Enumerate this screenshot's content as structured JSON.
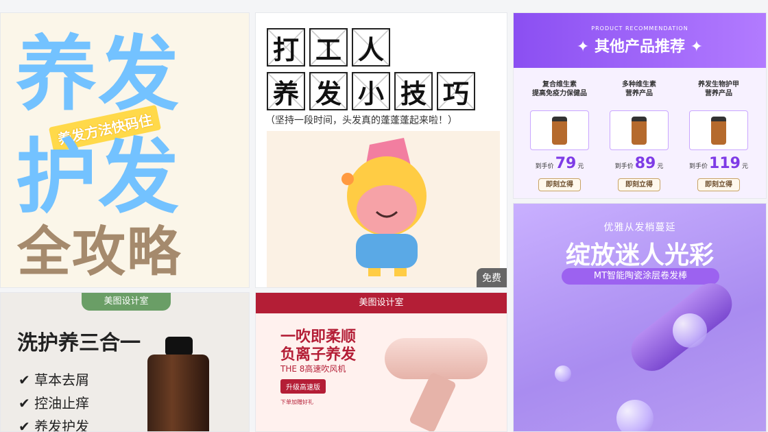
{
  "card1": {
    "line1": "养发",
    "line2": "护发",
    "line3": "全攻略",
    "tag": "养发方法快码住"
  },
  "card2": {
    "row1": [
      "打",
      "工",
      "人"
    ],
    "row2": [
      "养",
      "发",
      "小",
      "技",
      "巧"
    ],
    "subtitle": "（坚持一段时间，头发真的蓬蓬蓬起来啦！）",
    "badge": "免费"
  },
  "card3": {
    "en": "PRODUCT RECOMMENDATION",
    "title": "✦ 其他产品推荐 ✦",
    "products": [
      {
        "name": "复合维生素",
        "desc": "提高免疫力保健品",
        "price_label": "到手价",
        "price": "79",
        "unit": "元",
        "buy": "即刻立得"
      },
      {
        "name": "多种维生素",
        "desc": "营养产品",
        "price_label": "到手价",
        "price": "89",
        "unit": "元",
        "buy": "即刻立得"
      },
      {
        "name": "养发生物护甲",
        "desc": "营养产品",
        "price_label": "到手价",
        "price": "119",
        "unit": "元",
        "buy": "即刻立得"
      }
    ]
  },
  "card4": {
    "top": "优雅从发梢蔓延",
    "title": "绽放迷人光彩",
    "pill": "MT智能陶瓷涂层卷发棒"
  },
  "card5": {
    "brand": "美图设计室",
    "title": "洗护养三合一",
    "items": [
      "✔ 草本去屑",
      "✔ 控油止痒",
      "✔ 养发护发"
    ]
  },
  "card6": {
    "brand": "美图设计室",
    "l1": "一吹即柔顺",
    "l2": "负离子养发",
    "l3": "THE 8高速吹风机",
    "l4": "升级高速版",
    "l5": "下单加赠好礼"
  }
}
